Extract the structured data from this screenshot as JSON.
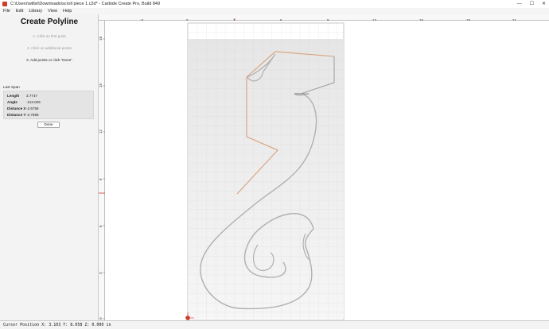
{
  "window": {
    "title": "C:\\Users\\willst\\Downloads\\scroll piece 1.c2d* - Carbide Create Pro, Build 849",
    "controls": [
      "—",
      "☐",
      "✕"
    ]
  },
  "menu": [
    "File",
    "Edit",
    "Library",
    "View",
    "Help"
  ],
  "panel": {
    "title": "Create Polyline",
    "steps": [
      "1. Click on first point",
      "2. Click on additional points",
      "3. Add points or click \"Done\""
    ],
    "last_span_label": "Last Span",
    "rows": [
      {
        "label": "Length",
        "value": "3.7747"
      },
      {
        "label": "Angle",
        "value": "-113.025"
      },
      {
        "label": "Distance X",
        "value": "-2.5756"
      },
      {
        "label": "Distance Y",
        "value": "-2.7595"
      }
    ],
    "done_label": "Done"
  },
  "ruler": {
    "top_ticks": [
      "-3",
      "0",
      "3",
      "6",
      "9",
      "12",
      "15",
      "18",
      "21"
    ],
    "left_ticks": [
      "18",
      "15",
      "12",
      "9",
      "6",
      "3",
      "0"
    ]
  },
  "status": {
    "cursor_text": "Cursor Position X: 3.103 Y: 8.058 Z: 0.000 in"
  },
  "colors": {
    "accent": "#d23a2a",
    "polyline": "#d9a07a",
    "grid": "#cfcfcf",
    "outline": "#a9a9a9"
  }
}
